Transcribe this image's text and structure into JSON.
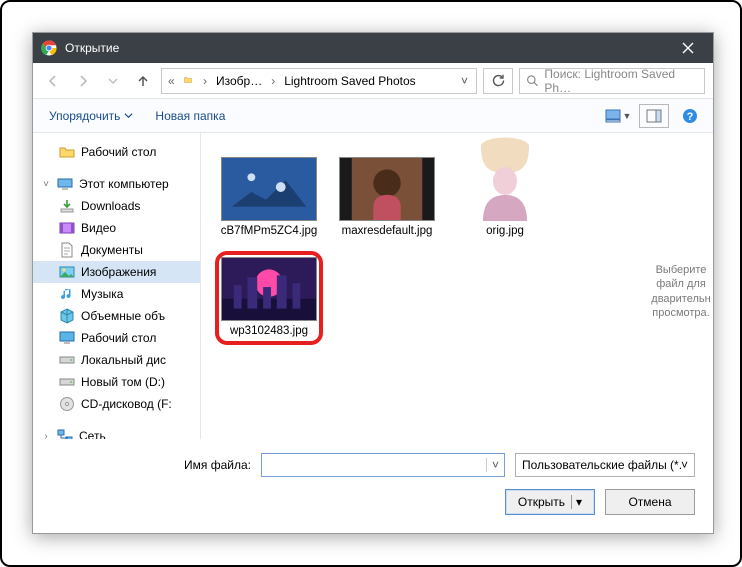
{
  "window": {
    "title": "Открытие"
  },
  "addressbar": {
    "crumbs": [
      "Изобр…",
      "Lightroom Saved Photos"
    ]
  },
  "search": {
    "placeholder": "Поиск: Lightroom Saved Ph…"
  },
  "commandbar": {
    "organize": "Упорядочить",
    "newfolder": "Новая папка"
  },
  "tree": {
    "desktop": "Рабочий стол",
    "thispc": "Этот компьютер",
    "downloads": "Downloads",
    "videos": "Видео",
    "documents": "Документы",
    "pictures": "Изображения",
    "music": "Музыка",
    "volumes3d": "Объемные объ",
    "desktop2": "Рабочий стол",
    "localc": "Локальный дис",
    "newvold": "Новый том (D:)",
    "cddrive": "CD-дисковод (F:",
    "network": "Сеть"
  },
  "files": [
    {
      "name": "cB7fMPm5ZC4.jpg"
    },
    {
      "name": "maxresdefault.jpg"
    },
    {
      "name": "orig.jpg"
    },
    {
      "name": "wp3102483.jpg"
    }
  ],
  "preview": {
    "message": "Выберите файл для дварительн просмотра."
  },
  "footer": {
    "filename_label": "Имя файла:",
    "filename_value": "",
    "filter": "Пользовательские файлы (*.jf",
    "open": "Открыть",
    "cancel": "Отмена"
  }
}
